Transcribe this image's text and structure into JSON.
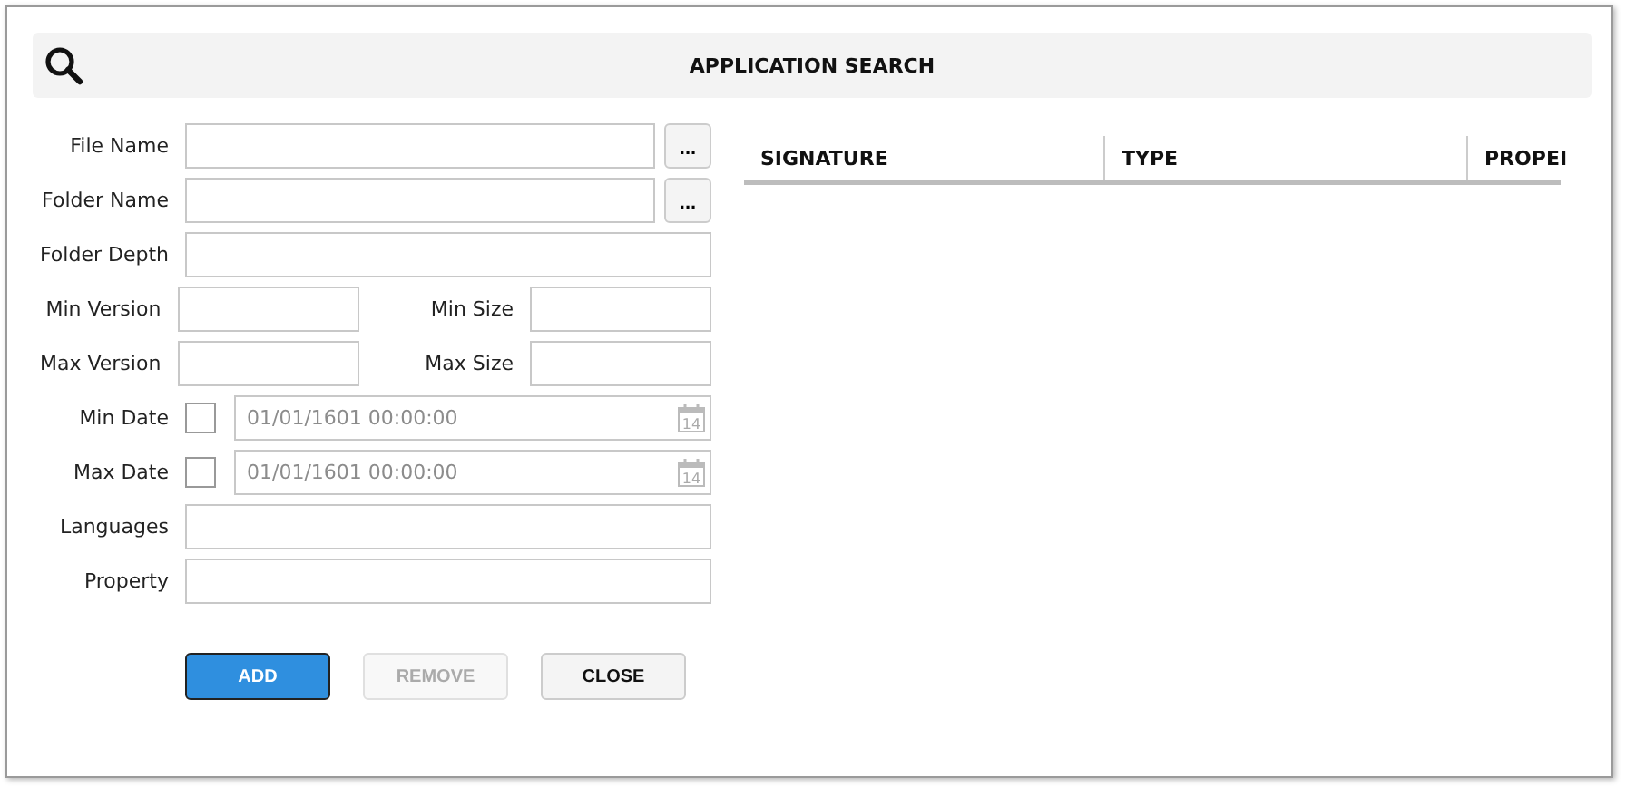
{
  "header": {
    "title": "APPLICATION SEARCH"
  },
  "form": [
    {
      "kind": "browse",
      "label": "File Name",
      "button": "..."
    },
    {
      "kind": "browse",
      "label": "Folder Name",
      "button": "..."
    },
    {
      "kind": "text",
      "label": "Folder Depth"
    },
    {
      "kind": "pair",
      "fields": [
        {
          "label": "Min Version"
        },
        {
          "label": "Min Size"
        }
      ]
    },
    {
      "kind": "pair",
      "fields": [
        {
          "label": "Max Version"
        },
        {
          "label": "Max Size"
        }
      ]
    },
    {
      "kind": "date",
      "label": "Min Date",
      "checked": false,
      "value": "01/01/1601 00:00:00",
      "day": "14"
    },
    {
      "kind": "date",
      "label": "Max Date",
      "checked": false,
      "value": "01/01/1601 00:00:00",
      "day": "14"
    },
    {
      "kind": "text",
      "label": "Languages"
    },
    {
      "kind": "text",
      "label": "Property"
    }
  ],
  "buttons": [
    {
      "label": "ADD",
      "kind": "primary",
      "disabled": false
    },
    {
      "label": "REMOVE",
      "kind": "normal",
      "disabled": true
    },
    {
      "label": "CLOSE",
      "kind": "normal",
      "disabled": false
    }
  ],
  "table": {
    "columns": [
      "SIGNATURE",
      "TYPE",
      "PROPEI"
    ]
  }
}
